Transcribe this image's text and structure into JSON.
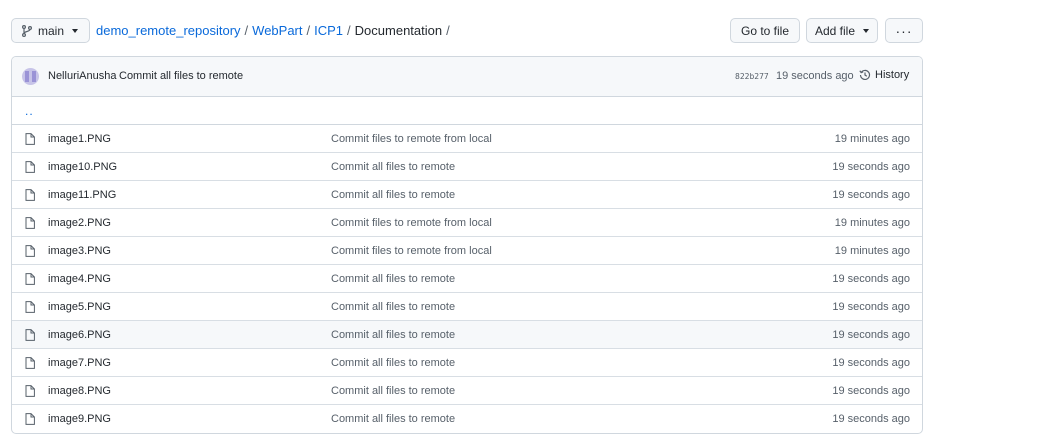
{
  "branch": {
    "icon": "git-branch-icon",
    "label": "main"
  },
  "breadcrumb": {
    "repo": "demo_remote_repository",
    "folder1": "WebPart",
    "folder2": "ICP1",
    "current": "Documentation",
    "separator": "/"
  },
  "buttons": {
    "go_to_file": "Go to file",
    "add_file": "Add file",
    "more": "···"
  },
  "commit": {
    "author": "NelluriAnusha",
    "message": "Commit all files to remote",
    "sha": "822b277",
    "time": "19 seconds ago",
    "history_label": "History"
  },
  "parent_dir": "..",
  "files": [
    {
      "name": "image1.PNG",
      "message": "Commit files to remote from local",
      "time": "19 minutes ago"
    },
    {
      "name": "image10.PNG",
      "message": "Commit all files to remote",
      "time": "19 seconds ago"
    },
    {
      "name": "image11.PNG",
      "message": "Commit all files to remote",
      "time": "19 seconds ago"
    },
    {
      "name": "image2.PNG",
      "message": "Commit files to remote from local",
      "time": "19 minutes ago"
    },
    {
      "name": "image3.PNG",
      "message": "Commit files to remote from local",
      "time": "19 minutes ago"
    },
    {
      "name": "image4.PNG",
      "message": "Commit all files to remote",
      "time": "19 seconds ago"
    },
    {
      "name": "image5.PNG",
      "message": "Commit all files to remote",
      "time": "19 seconds ago"
    },
    {
      "name": "image6.PNG",
      "message": "Commit all files to remote",
      "time": "19 seconds ago"
    },
    {
      "name": "image7.PNG",
      "message": "Commit all files to remote",
      "time": "19 seconds ago"
    },
    {
      "name": "image8.PNG",
      "message": "Commit all files to remote",
      "time": "19 seconds ago"
    },
    {
      "name": "image9.PNG",
      "message": "Commit all files to remote",
      "time": "19 seconds ago"
    }
  ],
  "colors": {
    "link": "#0969da",
    "muted": "#57606a",
    "border": "#d0d7de"
  }
}
